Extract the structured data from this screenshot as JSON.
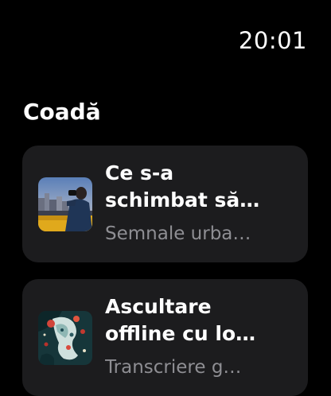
{
  "status_bar": {
    "time": "20:01"
  },
  "queue": {
    "title": "Coadă",
    "items": [
      {
        "title": "Ce s-a schimbat să…",
        "subtitle": "Semnale urba…",
        "artwork_icon": "city-photographer-artwork"
      },
      {
        "title": "Ascultare offline cu lo…",
        "subtitle": "Transcriere g…",
        "artwork_icon": "abstract-paint-artwork"
      }
    ]
  },
  "colors": {
    "background": "#000000",
    "card": "#1c1c1e",
    "secondary_text": "#8e8e93"
  }
}
